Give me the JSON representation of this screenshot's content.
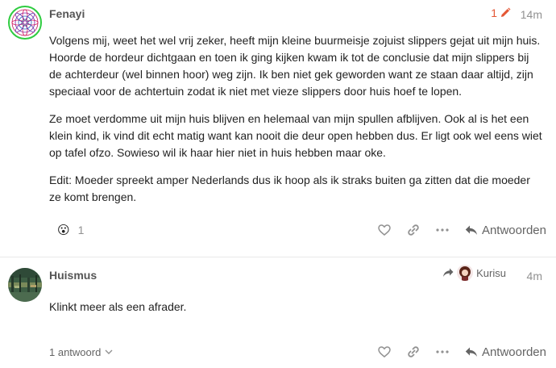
{
  "posts": [
    {
      "username": "Fenayi",
      "edit_count": "1",
      "time": "14m",
      "paragraphs": [
        "Volgens mij, weet het wel vrij zeker, heeft mijn kleine buurmeisje zojuist slippers gejat uit mijn huis. Hoorde de hordeur dichtgaan en toen ik ging kijken kwam ik tot de conclusie dat mijn slippers bij de achterdeur (wel binnen hoor) weg zijn. Ik ben niet gek geworden want ze staan daar altijd, zijn speciaal voor de achtertuin zodat ik niet met vieze slippers door huis hoef te lopen.",
        "Ze moet verdomme uit mijn huis blijven en helemaal van mijn spullen afblijven. Ook al is het een klein kind, ik vind dit echt matig want kan nooit die deur open hebben dus. Er ligt ook wel eens wiet op tafel ofzo. Sowieso wil ik haar hier niet in huis hebben maar oke.",
        "Edit: Moeder spreekt amper Nederlands dus ik hoop als ik straks buiten ga zitten dat die moeder ze komt brengen."
      ],
      "reaction": {
        "emoji": "😮",
        "count": "1"
      },
      "reply_label": "Antwoorden"
    },
    {
      "username": "Huismus",
      "reply_to": "Kurisu",
      "time": "4m",
      "paragraphs": [
        "Klinkt meer als een afrader."
      ],
      "replies_label": "1 antwoord",
      "reply_label": "Antwoorden"
    }
  ],
  "colors": {
    "accent": "#e45735",
    "muted": "#919191",
    "avatar_ring": "#2ecc40"
  }
}
